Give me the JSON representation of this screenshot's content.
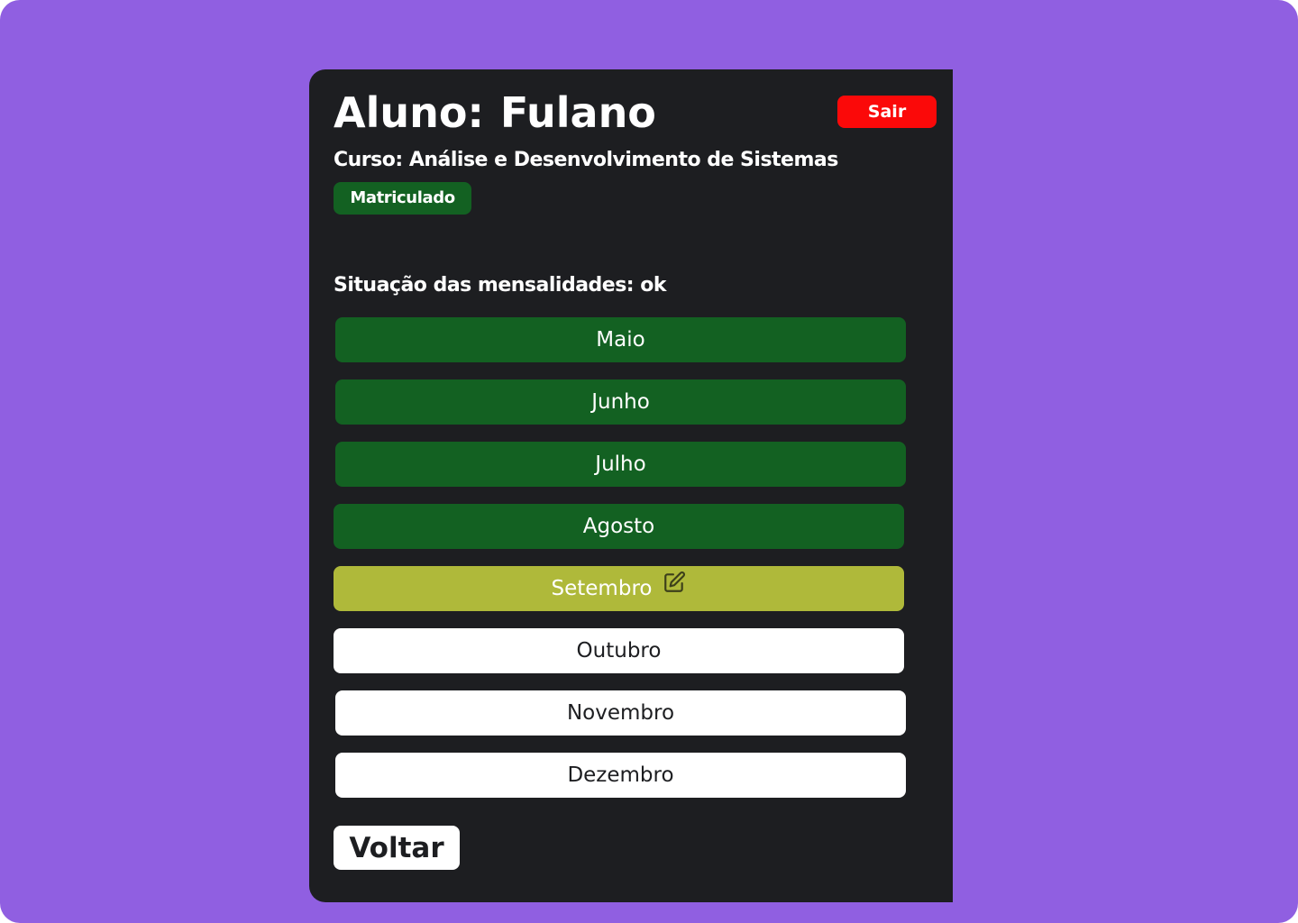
{
  "header": {
    "title_label": "Aluno:",
    "student_name": "Fulano",
    "logout_label": "Sair"
  },
  "course": {
    "text": "Curso: Análise e Desenvolvimento de Sistemas",
    "status_badge": "Matriculado"
  },
  "payments": {
    "heading": "Situação das mensalidades: ok",
    "months": [
      {
        "label": "Maio",
        "status": "paid"
      },
      {
        "label": "Junho",
        "status": "paid"
      },
      {
        "label": "Julho",
        "status": "paid"
      },
      {
        "label": "Agosto",
        "status": "paid"
      },
      {
        "label": "Setembro",
        "status": "current"
      },
      {
        "label": "Outubro",
        "status": "open"
      },
      {
        "label": "Novembro",
        "status": "open"
      },
      {
        "label": "Dezembro",
        "status": "open"
      }
    ]
  },
  "footer": {
    "back_label": "Voltar"
  },
  "colors": {
    "background": "#905fe1",
    "panel": "#1d1e21",
    "paid": "#136122",
    "current": "#afb93a",
    "open": "#ffffff",
    "logout": "#fb0909"
  },
  "icons": {
    "current_month": "edit-icon"
  }
}
